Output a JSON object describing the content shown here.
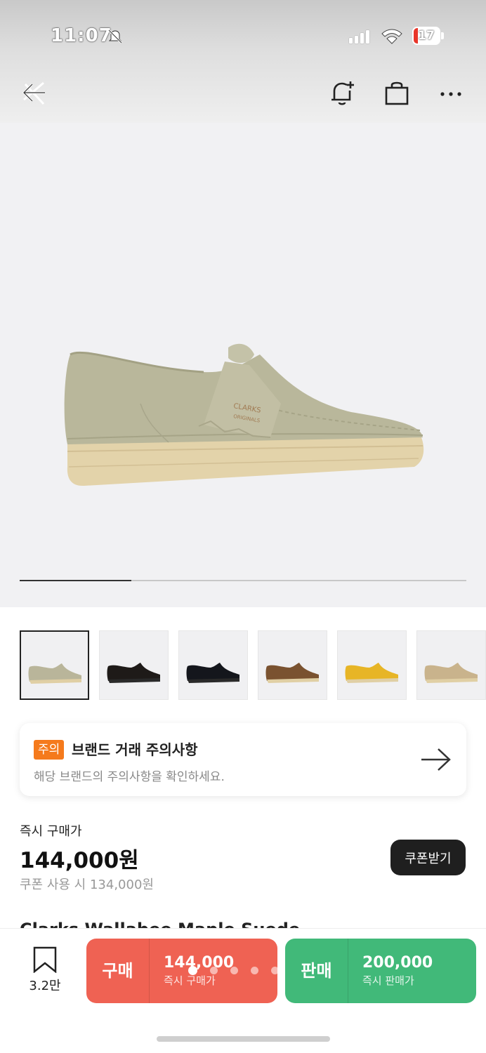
{
  "status_bar": {
    "time": "11:07",
    "battery_percent": 17,
    "battery_label": "17"
  },
  "nav": {
    "back_label": "back",
    "icons": [
      "back-close-icon",
      "bell-plus-icon",
      "shopping-bag-icon",
      "more-icon"
    ]
  },
  "hero": {
    "logo_line1": "CLARKS",
    "logo_line2": "ORIGINALS",
    "carousel_progress": 0.25
  },
  "thumbnails": [
    {
      "color": "#b9b59a",
      "selected": true
    },
    {
      "color": "#1e1a18",
      "selected": false
    },
    {
      "color": "#14161c",
      "selected": false
    },
    {
      "color": "#7a5230",
      "selected": false
    },
    {
      "color": "#e7b526",
      "selected": false
    },
    {
      "color": "#c9b38c",
      "selected": false
    }
  ],
  "notice": {
    "badge": "주의",
    "title": "브랜드 거래 주의사항",
    "subtitle": "해당 브랜드의 주의사항을 확인하세요."
  },
  "price": {
    "label": "즉시 구매가",
    "value": "144,000원",
    "coupon_text": "쿠폰 사용 시 134,000원",
    "coupon_button": "쿠폰받기"
  },
  "product_title_cut": "Clarks Wallabee Maple Suede",
  "bottom_bar": {
    "bookmark_count": "3.2만",
    "buy": {
      "kind": "구매",
      "amount": "144,000",
      "sub": "즉시 구매가"
    },
    "sell": {
      "kind": "판매",
      "amount": "200,000",
      "sub": "즉시 판매가"
    }
  },
  "colors": {
    "buy": "#ef6253",
    "sell": "#41b979",
    "badge": "#f57a1c"
  }
}
